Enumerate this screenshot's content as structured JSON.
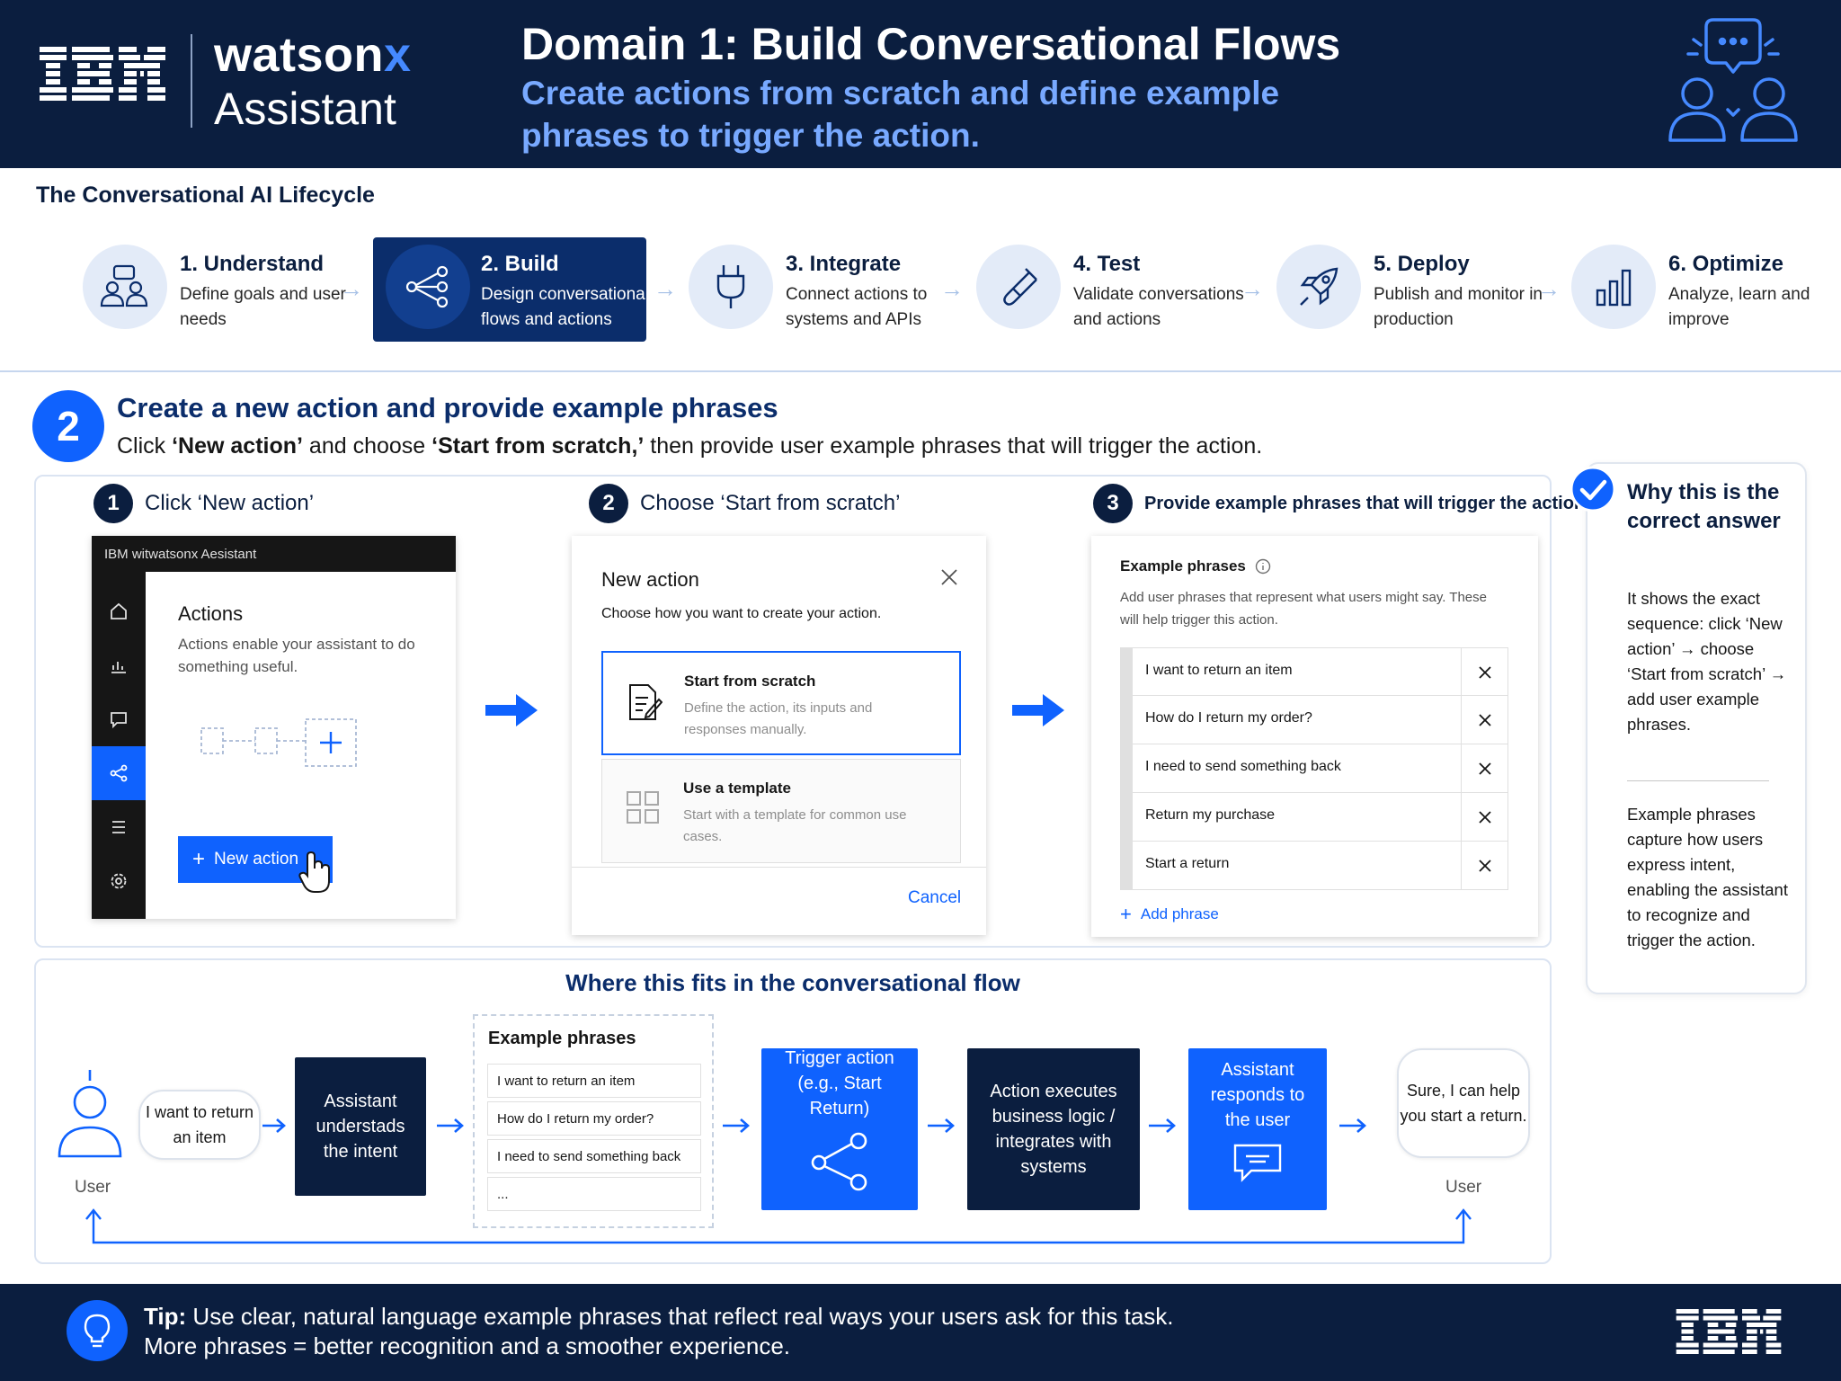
{
  "header": {
    "logo_text": "IBM",
    "brand_name_main": "watson",
    "brand_name_accent": "x",
    "brand_product": "Assistant",
    "title": "Domain 1: Build Conversational Flows",
    "subtitle": "Create actions from scratch and define example phrases to trigger the action.",
    "icons": [
      "ibm-logo",
      "chat-people-icon"
    ]
  },
  "lifecycle": {
    "title": "The Conversational AI Lifecycle",
    "stages": [
      {
        "title": "1. Understand",
        "desc": "Define goals and user needs",
        "icon": "people-chat-icon"
      },
      {
        "title": "2. Build",
        "desc": "Design conversational flows and actions",
        "icon": "flow-nodes-icon",
        "active": true
      },
      {
        "title": "3. Integrate",
        "desc": "Connect actions to systems and APIs",
        "icon": "plug-icon"
      },
      {
        "title": "4. Test",
        "desc": "Validate conversations and actions",
        "icon": "test-tube-icon"
      },
      {
        "title": "5. Deploy",
        "desc": "Publish and monitor in production",
        "icon": "rocket-icon"
      },
      {
        "title": "6. Optimize",
        "desc": "Analyze, learn and improve",
        "icon": "bar-chart-icon"
      }
    ]
  },
  "section": {
    "badge": "2",
    "title": "Create a new action and provide example phrases",
    "desc_parts": [
      "Click ",
      "‘New action’",
      " and choose ",
      "‘Start from scratch,’",
      " then provide user example phrases that will trigger the action."
    ]
  },
  "steps": [
    {
      "num": "1",
      "title": "Click ‘New action’"
    },
    {
      "num": "2",
      "title": "Choose ‘Start from scratch’"
    },
    {
      "num": "3",
      "title": "Provide example phrases that will trigger the action"
    }
  ],
  "mock1": {
    "topbar": "IBM  witwatsonx Aesistant",
    "heading": "Actions",
    "desc": "Actions enable your assistant to do something useful.",
    "button": "New action"
  },
  "mock2": {
    "heading": "New action",
    "desc": "Choose how you want to create your action.",
    "options": [
      {
        "title": "Start from scratch",
        "desc": "Define the action, its inputs and responses manually."
      },
      {
        "title": "Use a template",
        "desc": "Start with a template for common use cases."
      }
    ],
    "cancel": "Cancel"
  },
  "mock3": {
    "heading": "Example phrases",
    "desc": "Add user phrases that represent what users might say. These will help trigger this action.",
    "phrases": [
      "I want to return an item",
      "How do I return my order?",
      "I need to send something back",
      "Return my purchase",
      "Start a return"
    ],
    "add": "Add phrase"
  },
  "why": {
    "title": "Why this is the correct answer",
    "p1": "It shows the exact sequence: click ‘New action’ → choose ‘Start from scratch’ → add user example phrases.",
    "p2": "Example phrases capture how users express intent, enabling the assistant to recognize and trigger the action."
  },
  "flow": {
    "title": "Where this fits in the conversational flow",
    "user_label": "User",
    "user_bubble": "I want to return an item",
    "understands": "Assistant understads the intent",
    "ep_title": "Example phrases",
    "ep_rows": [
      "I want to return an item",
      "How do I return my order?",
      "I need to send something back",
      "..."
    ],
    "trigger": "Trigger action (e.g., Start Return)",
    "executes": "Action executes business logic / integrates with systems",
    "responds": "Assistant responds to the user",
    "reply_bubble": "Sure, I can help you start a return.",
    "user_label_right": "User"
  },
  "footer": {
    "tip_label": "Tip:",
    "tip_line1": " Use clear, natural language example phrases that reflect real ways your users ask for this task.",
    "tip_line2": "More phrases = better recognition and a smoother experience.",
    "logo_text": "IBM"
  },
  "colors": {
    "navy": "#0b1e3f",
    "ibm_blue": "#0f62fe",
    "light_blue": "#78a9ff",
    "pale": "#e3ebf8"
  }
}
